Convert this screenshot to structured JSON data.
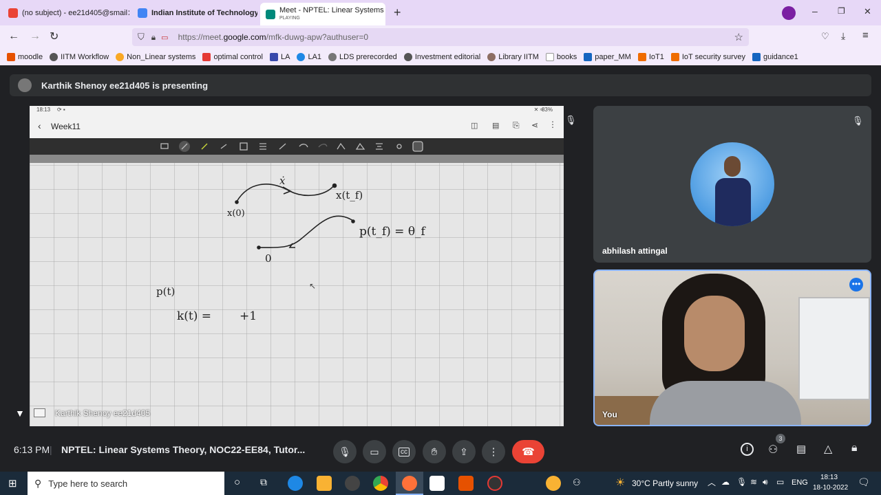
{
  "tabs": [
    {
      "label": "(no subject) - ee21d405@smail",
      "color": "#ea4335"
    },
    {
      "label": "Indian Institute of Technology",
      "color": "#4285f4"
    },
    {
      "label": "Meet - NPTEL: Linear Systems Th",
      "sublabel": "PLAYING",
      "color": "#00897b"
    }
  ],
  "url": {
    "prefix": "https://meet.",
    "domain": "google.com",
    "path": "/mfk-duwg-apw?authuser=0"
  },
  "bookmarks": [
    "moodle",
    "IITM Workflow",
    "Non_Linear systems",
    "optimal control",
    "LA",
    "LA1",
    "LDS prerecorded",
    "Investment editorial",
    "Library IITM",
    "books",
    "paper_MM",
    "IoT1",
    "IoT security survey",
    "guidance1"
  ],
  "banner": "Karthik Shenoy ee21d405 is presenting",
  "tablet": {
    "time": "18:13",
    "battery": "83%",
    "notebook": "Week11",
    "presenter_label": "Karthik Shenoy ee21d405"
  },
  "sketch": {
    "xdot": "ẋ",
    "x0": "x(0)",
    "xtf": "x(t_f)",
    "zero": "0",
    "ptf": "p(t_f) = θ_f",
    "pt": "p(t)",
    "kt": "k(t) =",
    "plus1": "+1"
  },
  "participants": [
    {
      "name": "abhilash attingal"
    },
    {
      "name": "You"
    }
  ],
  "bottom": {
    "time": "6:13 PM",
    "title": "NPTEL: Linear Systems Theory, NOC22-EE84, Tutor...",
    "people_count": "3"
  },
  "taskbar": {
    "search_placeholder": "Type here to search",
    "weather": "30°C  Partly sunny",
    "lang": "ENG",
    "time": "18:13",
    "date": "18-10-2022"
  }
}
